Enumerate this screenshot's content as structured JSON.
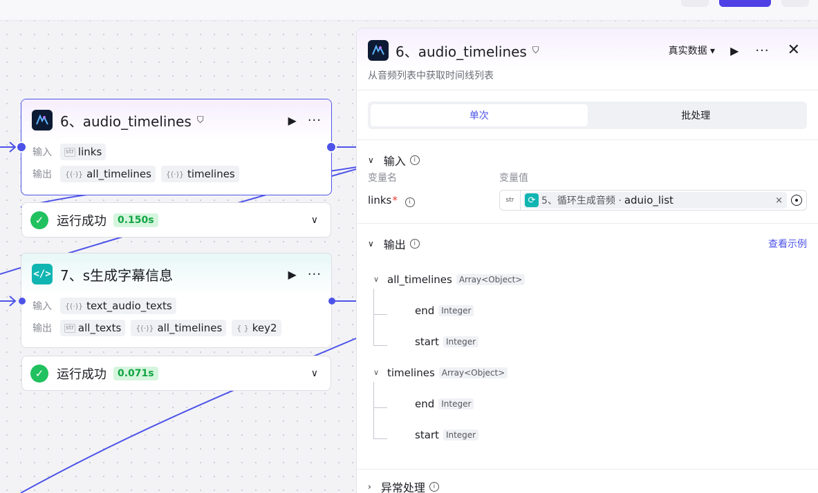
{
  "nodes": {
    "n6": {
      "title": "6、audio_timelines",
      "input_label": "输入",
      "output_label": "输出",
      "inputs": [
        {
          "type": "str",
          "name": "links"
        }
      ],
      "outputs": [
        {
          "type": "{(·)}",
          "name": "all_timelines"
        },
        {
          "type": "{(·)}",
          "name": "timelines"
        }
      ],
      "status": "运行成功",
      "time": "0.150s"
    },
    "n7": {
      "title": "7、s生成字幕信息",
      "logo": "</>",
      "input_label": "输入",
      "output_label": "输出",
      "inputs": [
        {
          "type": "{(·)}",
          "name": "text_audio_texts"
        }
      ],
      "outputs": [
        {
          "type": "str",
          "name": "all_texts"
        },
        {
          "type": "{(·)}",
          "name": "all_timelines"
        },
        {
          "type": "{ }",
          "name": "key2"
        }
      ],
      "status": "运行成功",
      "time": "0.071s"
    }
  },
  "panel": {
    "title": "6、audio_timelines",
    "mode": "真实数据",
    "description": "从音频列表中获取时间线列表",
    "tabs": [
      "单次",
      "批处理"
    ],
    "input_section": "输入",
    "var_name_header": "变量名",
    "var_value_header": "变量值",
    "var": {
      "name": "links",
      "required_mark": "*",
      "type": "str",
      "ref_node": "5、循环生成音频 ·",
      "ref_var": "aduio_list",
      "clear": "×"
    },
    "output_section": "输出",
    "output_link": "查看示例",
    "outputs": [
      {
        "name": "all_timelines",
        "type": "Array<Object>",
        "children": [
          {
            "name": "end",
            "type": "Integer"
          },
          {
            "name": "start",
            "type": "Integer"
          }
        ]
      },
      {
        "name": "timelines",
        "type": "Array<Object>",
        "children": [
          {
            "name": "end",
            "type": "Integer"
          },
          {
            "name": "start",
            "type": "Integer"
          }
        ]
      }
    ],
    "error_section": "异常处理"
  },
  "icons": {
    "play": "play-icon",
    "more": "more-icon",
    "close": "close-icon",
    "check": "check-icon",
    "chevron": "chevron-down-icon",
    "info": "info-icon",
    "loop": "loop-icon",
    "target": "target-icon"
  },
  "colors": {
    "accent": "#4d53e8",
    "success": "#21c15f",
    "teal": "#10b5b2"
  }
}
